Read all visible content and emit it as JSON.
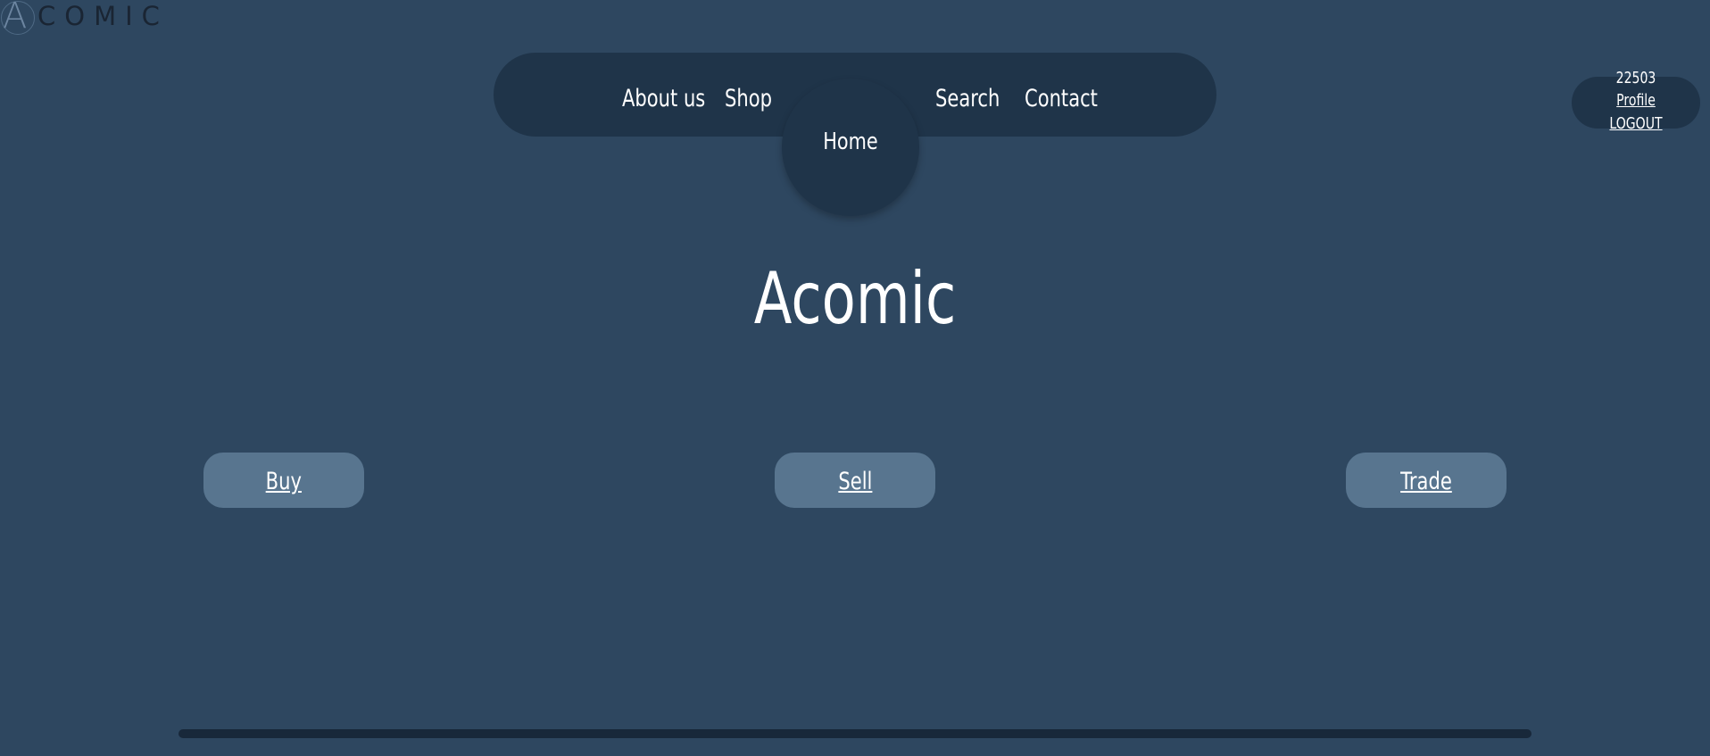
{
  "logo": {
    "letter": "A",
    "word": "COMIC"
  },
  "nav": {
    "about_label": "About us",
    "shop_label": "Shop",
    "home_label": "Home",
    "search_label": "Search",
    "contact_label": "Contact"
  },
  "user": {
    "id": "22503",
    "profile_label": "Profile",
    "logout_label": "LOGOUT"
  },
  "main": {
    "title": "Acomic",
    "actions": [
      {
        "label": "Buy"
      },
      {
        "label": "Sell"
      },
      {
        "label": "Trade"
      }
    ]
  }
}
